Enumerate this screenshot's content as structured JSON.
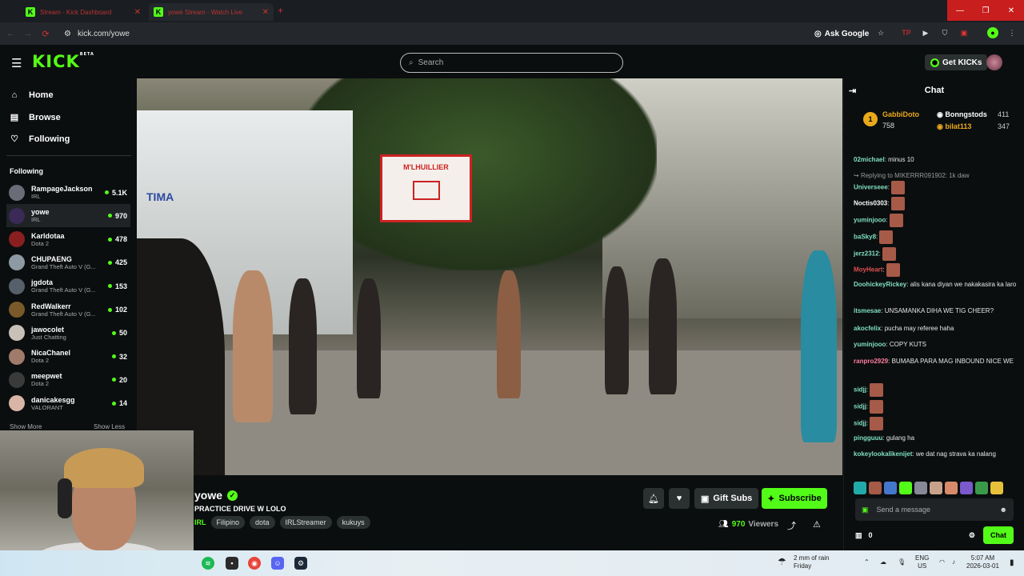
{
  "browser": {
    "tabs": [
      {
        "title": "Stream - Kick Dashboard"
      },
      {
        "title": "yowe Stream - Watch Live"
      }
    ],
    "url": "kick.com/yowe",
    "ask_google": "Ask Google"
  },
  "header": {
    "logo": "KICK",
    "logo_badge": "BETA",
    "search_placeholder": "Search",
    "get_kicks": "Get KICKs"
  },
  "sidebar": {
    "nav": [
      {
        "label": "Home",
        "icon": "home-icon"
      },
      {
        "label": "Browse",
        "icon": "browse-icon"
      },
      {
        "label": "Following",
        "icon": "heart-icon"
      }
    ],
    "following_heading": "Following",
    "channels": [
      {
        "name": "RampageJackson",
        "category": "IRL",
        "viewers": "5.1K",
        "color": "#6a6d78"
      },
      {
        "name": "yowe",
        "category": "IRL",
        "viewers": "970",
        "color": "#3a2a55"
      },
      {
        "name": "Karldotaa",
        "category": "Dota 2",
        "viewers": "478",
        "color": "#8a1f1f"
      },
      {
        "name": "CHUPAENG",
        "category": "Grand Theft Auto V (G...",
        "viewers": "425",
        "color": "#8d9aa3"
      },
      {
        "name": "jgdota",
        "category": "Grand Theft Auto V (G...",
        "viewers": "153",
        "color": "#55606a"
      },
      {
        "name": "RedWalkerr",
        "category": "Grand Theft Auto V (G...",
        "viewers": "102",
        "color": "#7a5a2a"
      },
      {
        "name": "jawocolet",
        "category": "Just Chatting",
        "viewers": "50",
        "color": "#c9c0b8"
      },
      {
        "name": "NicaChanel",
        "category": "Dota 2",
        "viewers": "32",
        "color": "#a07a6a"
      },
      {
        "name": "meepwet",
        "category": "Dota 2",
        "viewers": "20",
        "color": "#3a3a3a"
      },
      {
        "name": "danicakesgg",
        "category": "VALORANT",
        "viewers": "14",
        "color": "#d8b5a6"
      }
    ],
    "show_more": "Show More",
    "show_less": "Show Less"
  },
  "video": {
    "hoop_text": "M'LHUILLIER",
    "sign_text": "TIMA"
  },
  "stream": {
    "name": "yowe",
    "title": "PRACTICE DRIVE W LOLO",
    "category": "IRL",
    "tags": [
      "Filipino",
      "dota",
      "IRLStreamer",
      "kukuys"
    ],
    "gift_subs": "Gift Subs",
    "subscribe": "Subscribe",
    "viewer_count": "970",
    "viewers_label": "Viewers"
  },
  "chat": {
    "title": "Chat",
    "leaderboard": {
      "top": {
        "rank": "1",
        "name": "GabbiDoto",
        "value": "758"
      },
      "second": {
        "name": "Bonngstods",
        "value": "411"
      },
      "third": {
        "name": "bilat113",
        "value": "347"
      }
    },
    "messages": [
      {
        "user": "02michael",
        "color": "#7fe0c0",
        "text": "minus 10"
      },
      {
        "reply": "Replying to MIKERRR091902: 1k daw"
      },
      {
        "user": "Universeee",
        "color": "#7fe0c0",
        "text": "",
        "emote": true
      },
      {
        "user": "Noctis0303",
        "color": "#ffffff",
        "text": "",
        "emote": true
      },
      {
        "user": "yuminjooo",
        "color": "#7fe0c0",
        "text": "",
        "emote": true
      },
      {
        "user": "baSky8",
        "color": "#7fe0c0",
        "text": "",
        "emote": true
      },
      {
        "user": "jerz2312",
        "color": "#7fe0c0",
        "text": "",
        "emote": true
      },
      {
        "user": "MoyHeart",
        "color": "#e05050",
        "text": "",
        "emote": true
      },
      {
        "user": "DoohickeyRickey",
        "color": "#7fe0c0",
        "text": "alis kana diyan we nakakasira ka laro"
      },
      {
        "user": "itsmesae",
        "color": "#7fe0c0",
        "text": "UNSAMANKA DIHA WE TIG CHEER?"
      },
      {
        "user": "akocfelix",
        "color": "#7fe0c0",
        "text": "pucha may referee haha"
      },
      {
        "user": "yuminjooo",
        "color": "#7fe0c0",
        "text": "COPY KUTS"
      },
      {
        "user": "ranpro2929",
        "color": "#ff7fa0",
        "text": "BUMABA PARA MAG INBOUND NICE WE"
      },
      {
        "user": "sidjj",
        "color": "#7fe0c0",
        "text": "",
        "emote": true
      },
      {
        "user": "sidjj",
        "color": "#7fe0c0",
        "text": "",
        "emote": true
      },
      {
        "user": "sidjj",
        "color": "#7fe0c0",
        "text": "",
        "emote": true
      },
      {
        "user": "pingguuu",
        "color": "#7fe0c0",
        "text": "gulang ha"
      },
      {
        "user": "kokeylookalikenijet",
        "color": "#7fe0c0",
        "text": "we dat nag strava ka nalang"
      }
    ],
    "input_placeholder": "Send a message",
    "kicks_count": "0",
    "chat_button": "Chat"
  },
  "taskbar": {
    "weather": "2 mm of rain",
    "weather_day": "Friday",
    "lang": "ENG",
    "region": "US",
    "time": "5:07 AM",
    "date": "2026-03-01"
  }
}
